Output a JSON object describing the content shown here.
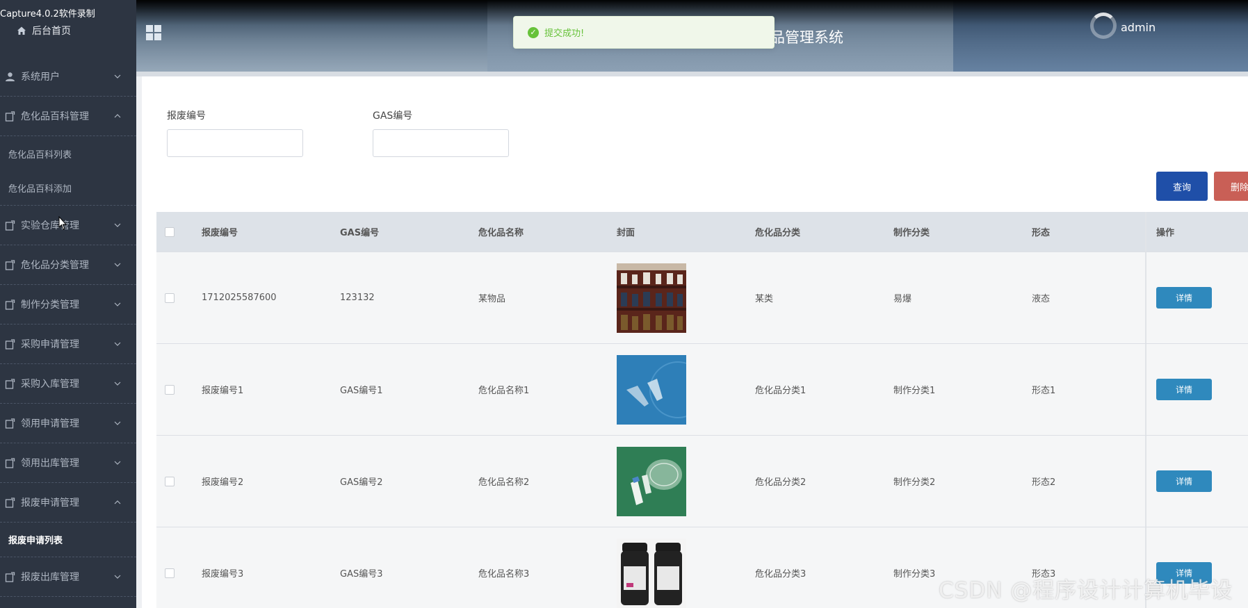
{
  "capture_tag": "Capture4.0.2软件录制",
  "sidebar": {
    "home_label": "后台首页",
    "items": [
      {
        "label": "系统用户",
        "icon": "user-icon",
        "expanded": false
      },
      {
        "label": "危化品百科管理",
        "icon": "clipboard-icon",
        "expanded": true,
        "children": [
          "危化品百科列表",
          "危化品百科添加"
        ]
      },
      {
        "label": "实验仓库管理",
        "icon": "clipboard-icon",
        "expanded": false
      },
      {
        "label": "危化品分类管理",
        "icon": "clipboard-icon",
        "expanded": false
      },
      {
        "label": "制作分类管理",
        "icon": "clipboard-icon",
        "expanded": false
      },
      {
        "label": "采购申请管理",
        "icon": "clipboard-icon",
        "expanded": false
      },
      {
        "label": "采购入库管理",
        "icon": "clipboard-icon",
        "expanded": false
      },
      {
        "label": "领用申请管理",
        "icon": "clipboard-icon",
        "expanded": false
      },
      {
        "label": "领用出库管理",
        "icon": "clipboard-icon",
        "expanded": false
      },
      {
        "label": "报废申请管理",
        "icon": "clipboard-icon",
        "expanded": true,
        "children": [
          "报废申请列表"
        ]
      },
      {
        "label": "报废出库管理",
        "icon": "clipboard-icon",
        "expanded": false
      }
    ]
  },
  "header": {
    "title": "品管理系统",
    "user": "admin"
  },
  "toast": {
    "message": "提交成功!"
  },
  "search": {
    "field1_label": "报废编号",
    "field1_value": "",
    "field2_label": "GAS编号",
    "field2_value": "",
    "query_label": "查询",
    "delete_label": "删除"
  },
  "table": {
    "columns": [
      "报废编号",
      "GAS编号",
      "危化品名称",
      "封面",
      "危化品分类",
      "制作分类",
      "形态",
      "操作"
    ],
    "rows": [
      {
        "id": "1712025587600",
        "gas": "123132",
        "name": "某物品",
        "cover": "shelf-bottles-image",
        "category": "某类",
        "make": "易爆",
        "form": "液态",
        "action": "详情"
      },
      {
        "id": "报废编号1",
        "gas": "GAS编号1",
        "name": "危化品名称1",
        "cover": "test-tubes-image",
        "category": "危化品分类1",
        "make": "制作分类1",
        "form": "形态1",
        "action": "详情"
      },
      {
        "id": "报废编号2",
        "gas": "GAS编号2",
        "name": "危化品名称2",
        "cover": "petri-dish-image",
        "category": "危化品分类2",
        "make": "制作分类2",
        "form": "形态2",
        "action": "详情"
      },
      {
        "id": "报废编号3",
        "gas": "GAS编号3",
        "name": "危化品名称3",
        "cover": "reagent-bottles-image",
        "category": "危化品分类3",
        "make": "制作分类3",
        "form": "形态3",
        "action": "详情"
      }
    ]
  },
  "watermark": "CSDN @程序设计计算机毕设"
}
